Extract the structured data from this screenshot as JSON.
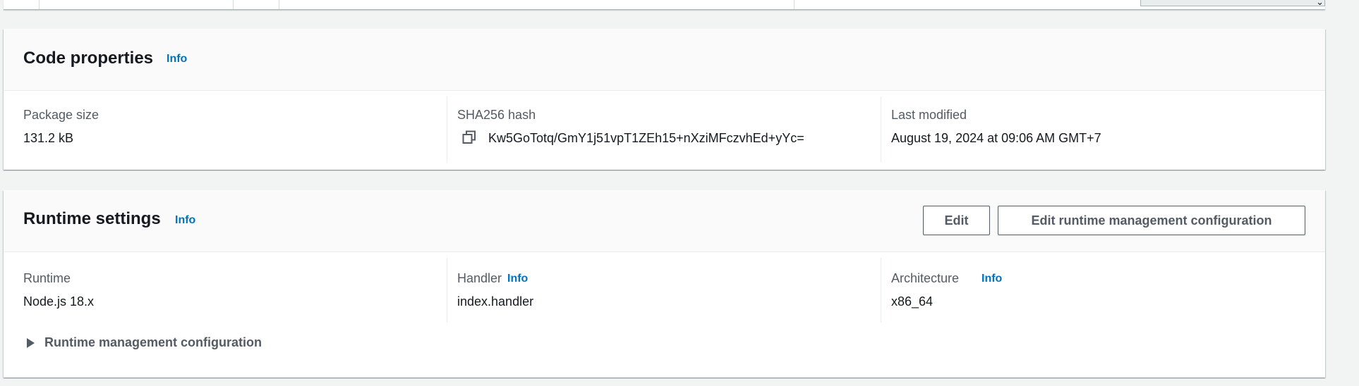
{
  "code_properties": {
    "title": "Code properties",
    "info": "Info",
    "package_size": {
      "label": "Package size",
      "value": "131.2 kB"
    },
    "sha256": {
      "label": "SHA256 hash",
      "value": "Kw5GoTotq/GmY1j51vpT1ZEh15+nXziMFczvhEd+yYc="
    },
    "last_modified": {
      "label": "Last modified",
      "value": "August 19, 2024 at 09:06 AM GMT+7"
    }
  },
  "runtime_settings": {
    "title": "Runtime settings",
    "info": "Info",
    "edit_button": "Edit",
    "edit_runtime_mgmt_button": "Edit runtime management configuration",
    "runtime": {
      "label": "Runtime",
      "value": "Node.js 18.x"
    },
    "handler": {
      "label": "Handler",
      "info": "Info",
      "value": "index.handler"
    },
    "architecture": {
      "label": "Architecture",
      "info": "Info",
      "value": "x86_64"
    },
    "expander_label": "Runtime management configuration"
  },
  "icons": {
    "copy": "copy-icon",
    "caret": "caret-right-icon",
    "dropdown": "chevron-down-icon"
  },
  "colors": {
    "link": "#0073bb",
    "text": "#16191f",
    "muted": "#545b64",
    "background": "#f2f3f3"
  }
}
